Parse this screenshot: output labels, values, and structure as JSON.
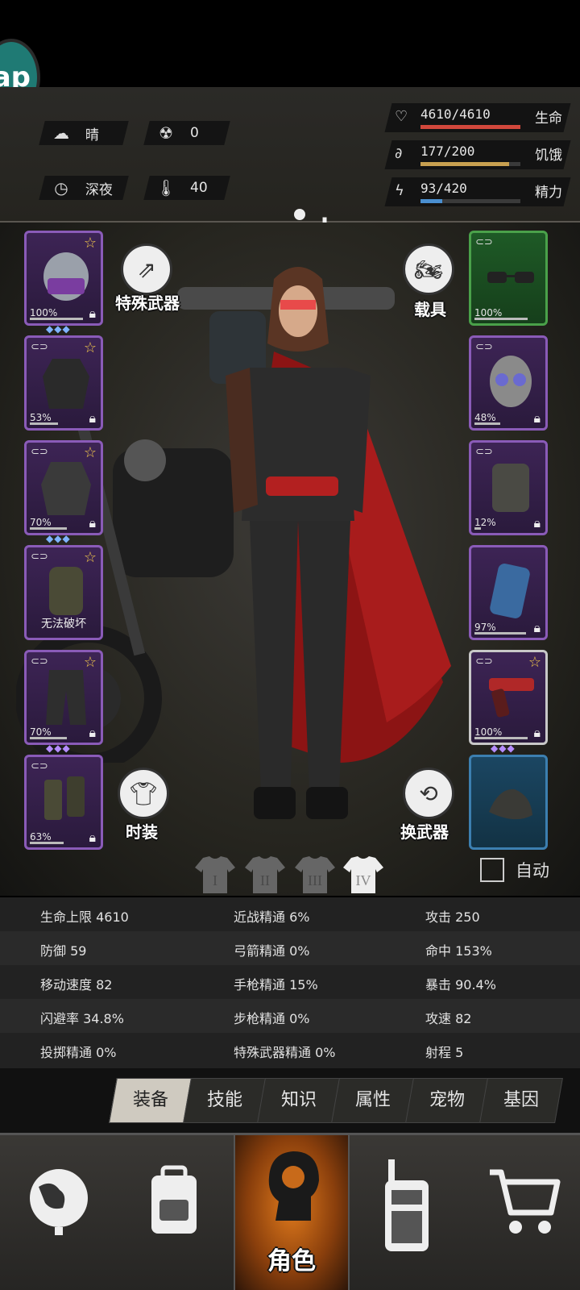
{
  "app_badge": "ap",
  "status": {
    "weather": {
      "icon": "cloud-sun-icon",
      "label": "晴"
    },
    "radiation": {
      "icon": "radiation-icon",
      "value": "0"
    },
    "time": {
      "icon": "clock-icon",
      "label": "深夜"
    },
    "temperature": {
      "icon": "thermometer-icon",
      "value": "40"
    },
    "vitals": [
      {
        "icon": "heart-icon",
        "value": "4610/4610",
        "name": "生命",
        "fill": 1.0,
        "color": "#d2483c"
      },
      {
        "icon": "stomach-icon",
        "value": "177/200",
        "name": "饥饿",
        "fill": 0.885,
        "color": "#c8a050"
      },
      {
        "icon": "energy-icon",
        "value": "93/420",
        "name": "精力",
        "fill": 0.221,
        "color": "#4a8fd0"
      }
    ]
  },
  "left_slots": [
    {
      "item": "riot-helmet",
      "pct": "100%",
      "durability": 1.0,
      "star": true,
      "lock": true,
      "gems": "◆◆◆",
      "rarity": "purple"
    },
    {
      "item": "jacket",
      "pct": "53%",
      "durability": 0.53,
      "star": true,
      "lock": true,
      "rarity": "purple"
    },
    {
      "item": "tactical-coat",
      "pct": "70%",
      "durability": 0.7,
      "star": true,
      "lock": true,
      "gems": "◆◆◆",
      "rarity": "purple"
    },
    {
      "item": "backpack",
      "label": "无法破坏",
      "star": true,
      "rarity": "purple"
    },
    {
      "item": "pants",
      "pct": "70%",
      "durability": 0.7,
      "star": true,
      "lock": true,
      "gems": "◆◆◆",
      "rarity": "purple"
    },
    {
      "item": "boots",
      "pct": "63%",
      "durability": 0.63,
      "lock": true,
      "rarity": "purple"
    }
  ],
  "right_slots": [
    {
      "item": "glasses",
      "pct": "100%",
      "durability": 1.0,
      "rarity": "green"
    },
    {
      "item": "gas-mask",
      "pct": "48%",
      "durability": 0.48,
      "lock": true,
      "rarity": "purple"
    },
    {
      "item": "vest",
      "pct": "12%",
      "durability": 0.12,
      "lock": true,
      "rarity": "purple"
    },
    {
      "item": "shield-pad",
      "pct": "97%",
      "durability": 0.97,
      "lock": true,
      "rarity": "purple"
    },
    {
      "item": "pistol",
      "pct": "100%",
      "durability": 1.0,
      "star": true,
      "lock": true,
      "gems": "◆◆◆",
      "rarity": "purple-selected"
    },
    {
      "item": "bag",
      "rarity": "blue"
    }
  ],
  "buttons": {
    "special_weapon": "特殊武器",
    "vehicle": "载具",
    "outfit": "时装",
    "swap_weapon": "换武器"
  },
  "outfit_tabs": [
    "I",
    "II",
    "III",
    "IV"
  ],
  "auto_label": "自动",
  "stats": [
    [
      "生命上限 4610",
      "近战精通 6%",
      "攻击 250"
    ],
    [
      "防御 59",
      "弓箭精通 0%",
      "命中 153%"
    ],
    [
      "移动速度 82",
      "手枪精通 15%",
      "暴击 90.4%"
    ],
    [
      "闪避率 34.8%",
      "步枪精通 0%",
      "攻速 82"
    ],
    [
      "投掷精通 0%",
      "特殊武器精通 0%",
      "射程 5"
    ]
  ],
  "sub_tabs": [
    "装备",
    "技能",
    "知识",
    "属性",
    "宠物",
    "基因"
  ],
  "bottom_nav": [
    {
      "icon": "globe-icon",
      "label": ""
    },
    {
      "icon": "backpack-icon",
      "label": ""
    },
    {
      "icon": "head-icon",
      "label": "角色"
    },
    {
      "icon": "radio-icon",
      "label": ""
    },
    {
      "icon": "cart-icon",
      "label": ""
    }
  ]
}
